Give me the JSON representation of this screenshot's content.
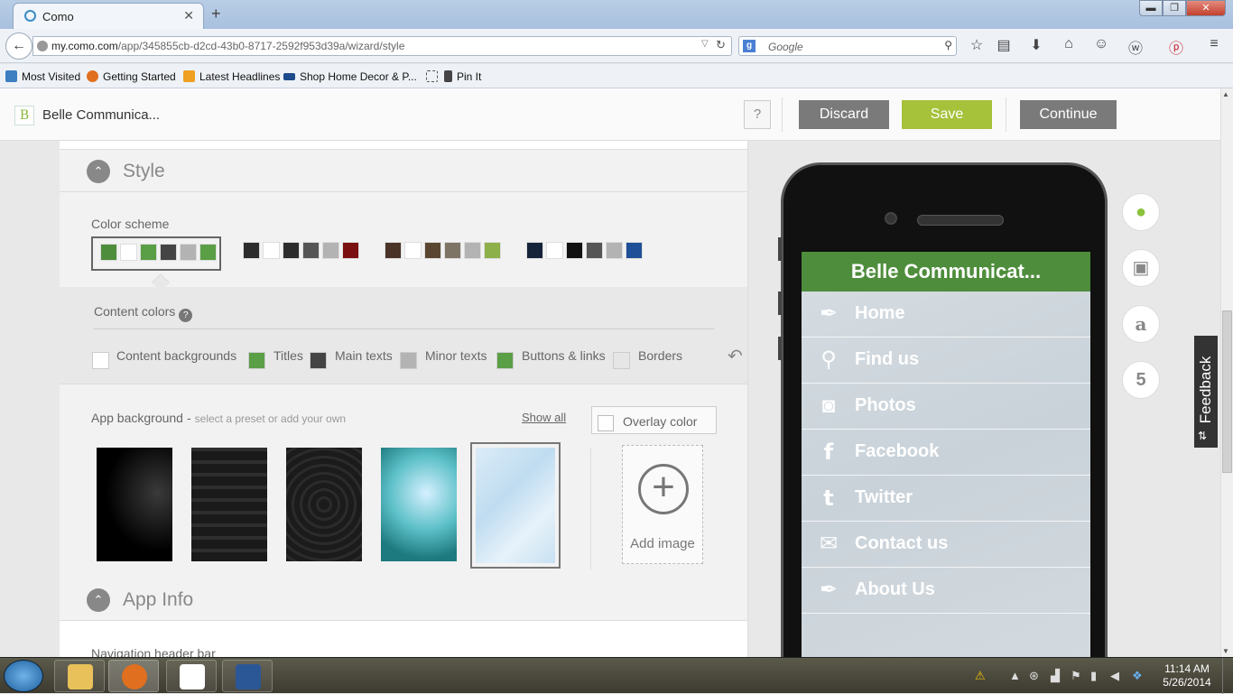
{
  "browser": {
    "tab_title": "Como",
    "new_tab_label": "+",
    "window_controls": {
      "minimize": "▬",
      "maximize": "❐",
      "close": "✕"
    },
    "url_host": "my.como.com",
    "url_path": "/app/345855cb-d2cd-43b0-8717-2592f953d39a/wizard/style",
    "search_placeholder": "Google",
    "search_engine_icon": "google-g-icon",
    "toolbar_icons": [
      "star-icon",
      "reader-icon",
      "download-icon",
      "home-icon",
      "persona-icon",
      "weave-icon",
      "pinterest-icon",
      "menu-icon"
    ],
    "bookmarks": [
      {
        "label": "Most Visited",
        "icon": "most-visited-icon",
        "color": "#3d7fc1"
      },
      {
        "label": "Getting Started",
        "icon": "firefox-icon",
        "color": "#e07020"
      },
      {
        "label": "Latest Headlines",
        "icon": "rss-icon",
        "color": "#f0a020"
      },
      {
        "label": "Shop Home Decor & P...",
        "icon": "shop-icon",
        "color": "#1d4a8a"
      },
      {
        "label": "",
        "icon": "blank-bookmark-icon",
        "color": "#ffffff"
      },
      {
        "label": "Pin It",
        "icon": "pin-it-icon",
        "color": "#444444"
      }
    ]
  },
  "header": {
    "logo_letter": "B",
    "app_name": "Belle Communica...",
    "help_label": "?",
    "discard_label": "Discard",
    "save_label": "Save",
    "continue_label": "Continue"
  },
  "style_section": {
    "title": "Style",
    "color_scheme_label": "Color scheme",
    "schemes": [
      {
        "selected": true,
        "colors": [
          "#4e8d3c",
          "#ffffff",
          "#5a9e46",
          "#444444",
          "#b3b3b3",
          "#5a9e46"
        ]
      },
      {
        "selected": false,
        "colors": [
          "#2c2c2c",
          "#ffffff",
          "#2c2c2c",
          "#555555",
          "#b3b3b3",
          "#7a1010"
        ]
      },
      {
        "selected": false,
        "colors": [
          "#4a3428",
          "#ffffff",
          "#5a4630",
          "#7e7466",
          "#b3b3b3",
          "#8db04a"
        ]
      },
      {
        "selected": false,
        "colors": [
          "#16243a",
          "#ffffff",
          "#111111",
          "#555555",
          "#b3b3b3",
          "#1f4f96"
        ]
      }
    ],
    "content_colors_label": "Content colors",
    "content_colors_help": "?",
    "content_colors": [
      {
        "label": "Content backgrounds",
        "color": "#ffffff"
      },
      {
        "label": "Titles",
        "color": "#5a9e46"
      },
      {
        "label": "Main texts",
        "color": "#444444"
      },
      {
        "label": "Minor texts",
        "color": "#b3b3b3"
      },
      {
        "label": "Buttons & links",
        "color": "#5a9e46"
      },
      {
        "label": "Borders",
        "color": "#e6e6e6"
      }
    ],
    "app_background_label": "App background",
    "app_background_sub": "select a preset or add your own",
    "show_all_label": "Show all",
    "overlay_color_label": "Overlay color",
    "add_image_label": "Add image"
  },
  "app_info_section": {
    "title": "App Info",
    "nav_header_label": "Navigation header bar"
  },
  "preview": {
    "screen_title": "Belle Communicat...",
    "menu": [
      {
        "label": "Home",
        "icon": "feather-icon",
        "glyph": "✒"
      },
      {
        "label": "Find us",
        "icon": "map-pin-icon",
        "glyph": "📍"
      },
      {
        "label": "Photos",
        "icon": "camera-icon",
        "glyph": "📷"
      },
      {
        "label": "Facebook",
        "icon": "facebook-icon",
        "glyph": "f"
      },
      {
        "label": "Twitter",
        "icon": "twitter-icon",
        "glyph": "t"
      },
      {
        "label": "Contact us",
        "icon": "envelope-icon",
        "glyph": "✉"
      },
      {
        "label": "About Us",
        "icon": "feather-icon",
        "glyph": "✒"
      }
    ],
    "platforms": [
      {
        "name": "apple-icon",
        "glyph": "",
        "color": "#8ac33a"
      },
      {
        "name": "android-icon",
        "glyph": "🤖",
        "color": "#888888"
      },
      {
        "name": "amazon-icon",
        "glyph": "a",
        "color": "#888888"
      },
      {
        "name": "html5-icon",
        "glyph": "5",
        "color": "#888888"
      }
    ],
    "brand_green": "#4e8d3c"
  },
  "feedback_label": "Feedback",
  "taskbar": {
    "apps": [
      "windows-explorer-icon",
      "firefox-icon",
      "dropbox-icon",
      "word-icon"
    ],
    "clock_time": "11:14 AM",
    "clock_date": "5/26/2014"
  }
}
